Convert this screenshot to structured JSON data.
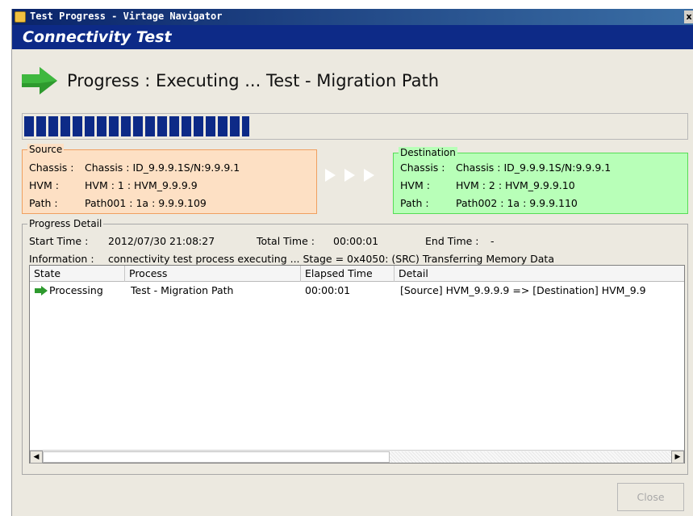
{
  "window": {
    "title": "Test Progress - Virtage Navigator",
    "close_glyph": "x"
  },
  "banner": {
    "title": "Connectivity Test"
  },
  "progress": {
    "heading": "Progress : Executing ...  Test - Migration Path",
    "fraction": 0.34
  },
  "source": {
    "legend": "Source",
    "rows": [
      {
        "key": "Chassis :",
        "value": "Chassis : ID_9.9.9.1S/N:9.9.9.1"
      },
      {
        "key": "HVM :",
        "value": "HVM : 1 : HVM_9.9.9.9"
      },
      {
        "key": "Path :",
        "value": "Path001 : 1a : 9.9.9.109"
      }
    ]
  },
  "destination": {
    "legend": "Destination",
    "rows": [
      {
        "key": "Chassis :",
        "value": "Chassis : ID_9.9.9.1S/N:9.9.9.1"
      },
      {
        "key": "HVM :",
        "value": "HVM : 2 : HVM_9.9.9.10"
      },
      {
        "key": "Path :",
        "value": "Path002 : 1a : 9.9.9.110"
      }
    ]
  },
  "detail": {
    "legend": "Progress Detail",
    "start_label": "Start Time :",
    "start_value": "2012/07/30 21:08:27",
    "total_label": "Total Time :",
    "total_value": "00:00:01",
    "end_label": "End Time :",
    "end_value": "-",
    "info_label": "Information :",
    "info_value": "connectivity test process executing ... Stage = 0x4050: (SRC) Transferring Memory Data",
    "columns": [
      "State",
      "Process",
      "Elapsed Time",
      "Detail"
    ],
    "rows": [
      {
        "state": "Processing",
        "process": "Test - Migration Path",
        "elapsed": "00:00:01",
        "detail": "[Source] HVM_9.9.9.9    => [Destination] HVM_9.9"
      }
    ],
    "scroll_left_glyph": "◀",
    "scroll_right_glyph": "▶"
  },
  "buttons": {
    "close": "Close"
  },
  "colors": {
    "banner": "#0d2a87",
    "progress_fill": "#0d2a87",
    "source_bg": "#fde0c4",
    "destination_bg": "#b8ffb8",
    "arrow_green": "#2e9a2e"
  },
  "icons": {
    "title": "app-cube-icon",
    "heading": "green-right-arrow-icon",
    "transfer": "triple-triangle-arrow-icon",
    "row_state": "green-right-arrow-icon"
  }
}
